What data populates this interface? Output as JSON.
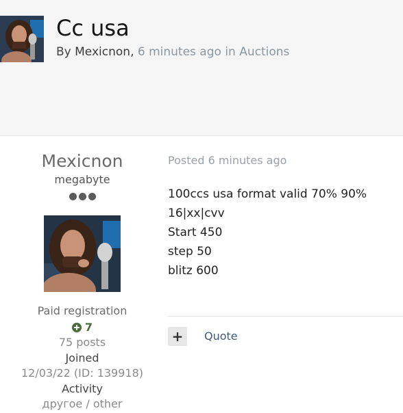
{
  "topic": {
    "title": "Cc usa",
    "by_prefix": "By ",
    "author": "Mexicnon",
    "time": "6 minutes ago",
    "in_prefix": " in ",
    "forum": "Auctions"
  },
  "profile": {
    "name": "Mexicnon",
    "rank": "megabyte",
    "rank_dots": 3,
    "group": "Paid registration",
    "reputation": "7",
    "posts": "75 posts",
    "joined_label": "Joined",
    "joined_value": "12/03/22  (ID: 139918)",
    "activity_label": "Activity",
    "activity_value": "другое / other"
  },
  "post": {
    "posted": "Posted 6 minutes ago",
    "lines": [
      "100ccs usa format valid 70% 90%",
      "16|xx|cvv",
      "Start 450",
      "step 50",
      "blitz 600"
    ]
  },
  "actions": {
    "plus_label": "+",
    "quote_label": "Quote"
  },
  "colors": {
    "header_bg": "#f5f5f5",
    "link": "#405b78",
    "reputation": "#4d6b3b"
  },
  "icons": [
    "avatar-photo",
    "rank-dots",
    "plus-circle-icon"
  ]
}
